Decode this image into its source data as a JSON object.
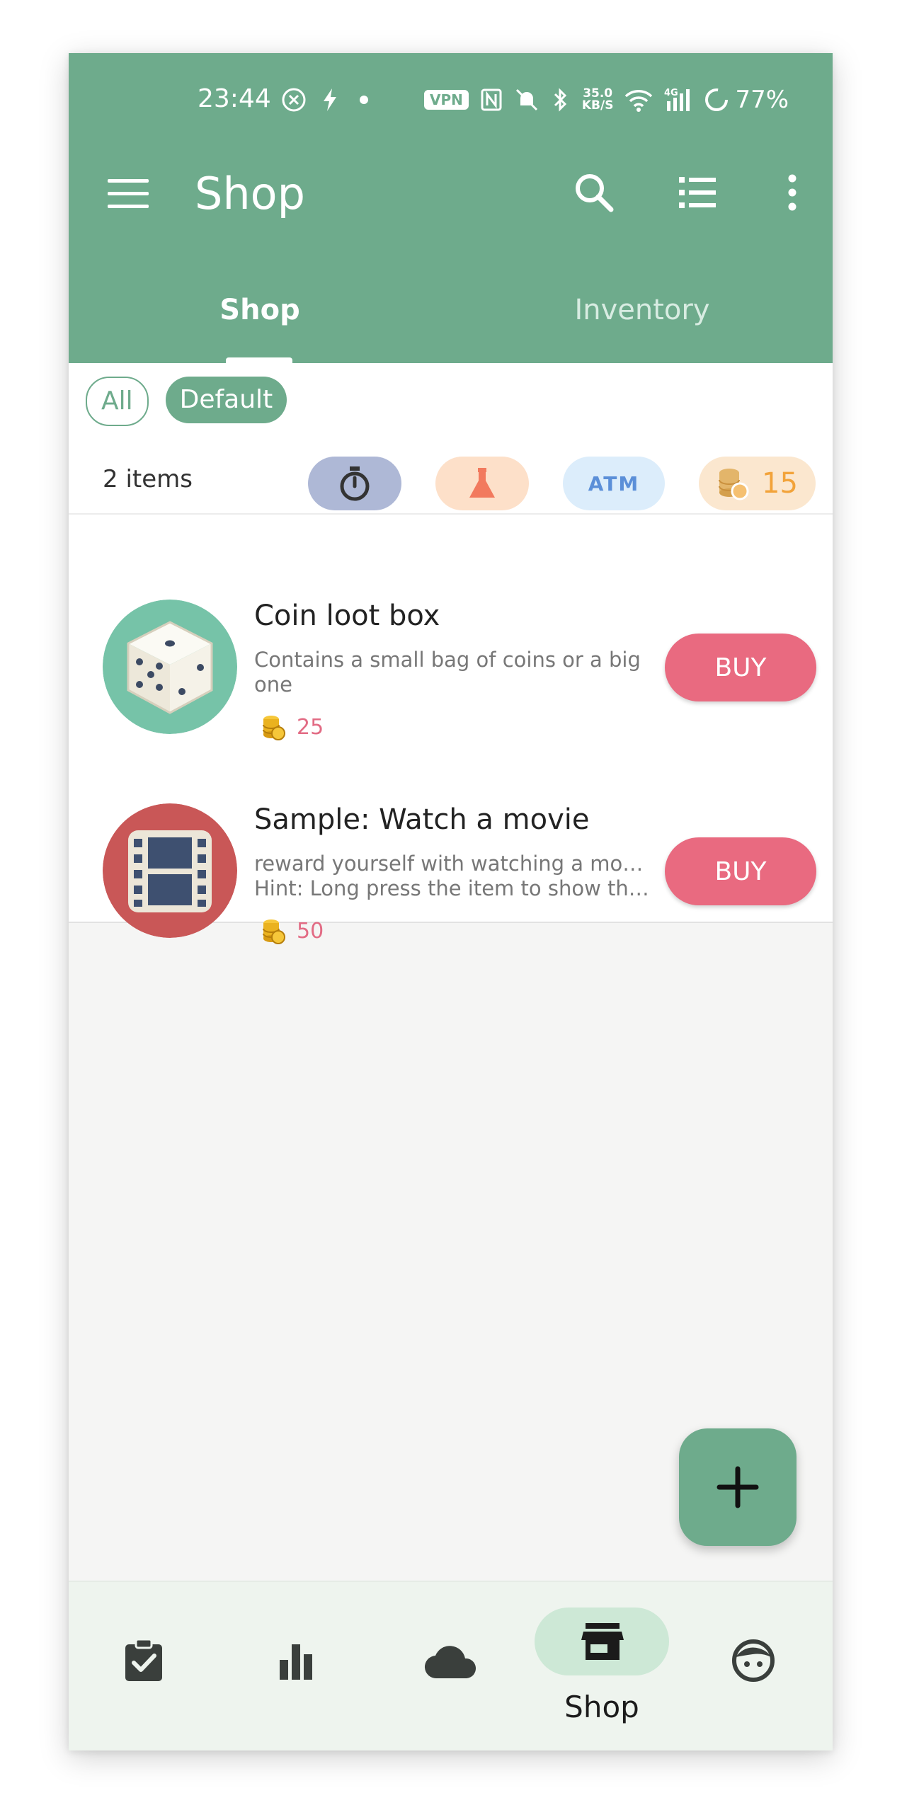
{
  "status_bar": {
    "time": "23:44",
    "vpn": "VPN",
    "speed": "35.0",
    "speed_unit": "KB/S",
    "net": "4G",
    "battery": "77%"
  },
  "toolbar": {
    "title": "Shop",
    "icons": [
      "menu-icon",
      "search-icon",
      "list-view-icon",
      "more-vert-icon"
    ]
  },
  "tabs": [
    {
      "label": "Shop",
      "active": true
    },
    {
      "label": "Inventory",
      "active": false
    }
  ],
  "filters": [
    {
      "label": "All",
      "selected": false
    },
    {
      "label": "Default",
      "selected": true
    }
  ],
  "summary": {
    "items_count": "2 items",
    "atm_label": "ATM",
    "gold": "15"
  },
  "items": [
    {
      "title": "Coin loot box",
      "description_line1": "Contains a small bag of coins or a big",
      "description_line2": "one",
      "price": "25",
      "buy_label": "BUY",
      "icon": "dice-icon",
      "color": "#76c3a8"
    },
    {
      "title": "Sample: Watch a movie",
      "description_line1": "reward yourself with watching a movie",
      "description_line2": "Hint: Long press the item to show the …",
      "price": "50",
      "buy_label": "BUY",
      "icon": "film-icon",
      "color": "#c95757"
    }
  ],
  "bottom_nav": {
    "items": [
      "tasks-icon",
      "stats-icon",
      "cloud-icon",
      "shop-icon",
      "profile-icon"
    ],
    "active_label": "Shop"
  },
  "colors": {
    "primary": "#6eab8c",
    "buy": "#e96a80",
    "price": "#e26b84",
    "gold": "#f2a33a"
  }
}
